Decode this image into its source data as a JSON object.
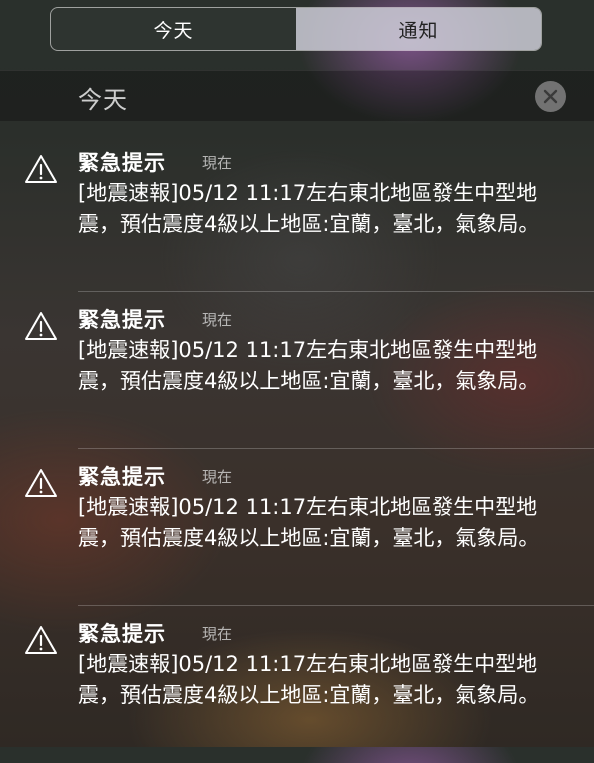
{
  "segment": {
    "tabs": [
      {
        "label": "今天",
        "selected": true
      },
      {
        "label": "通知",
        "selected": false
      }
    ]
  },
  "section": {
    "title": "今天",
    "clear_icon": "close-icon"
  },
  "notifications": [
    {
      "icon": "warning-icon",
      "title": "緊急提示",
      "time": "現在",
      "body": "[地震速報]05/12 11:17左右東北地區發生中型地震，預估震度4級以上地區:宜蘭，臺北，氣象局。"
    },
    {
      "icon": "warning-icon",
      "title": "緊急提示",
      "time": "現在",
      "body": "[地震速報]05/12 11:17左右東北地區發生中型地震，預估震度4級以上地區:宜蘭，臺北，氣象局。"
    },
    {
      "icon": "warning-icon",
      "title": "緊急提示",
      "time": "現在",
      "body": "[地震速報]05/12 11:17左右東北地區發生中型地震，預估震度4級以上地區:宜蘭，臺北，氣象局。"
    },
    {
      "icon": "warning-icon",
      "title": "緊急提示",
      "time": "現在",
      "body": "[地震速報]05/12 11:17左右東北地區發生中型地震，預估震度4級以上地區:宜蘭，臺北，氣象局。"
    }
  ]
}
